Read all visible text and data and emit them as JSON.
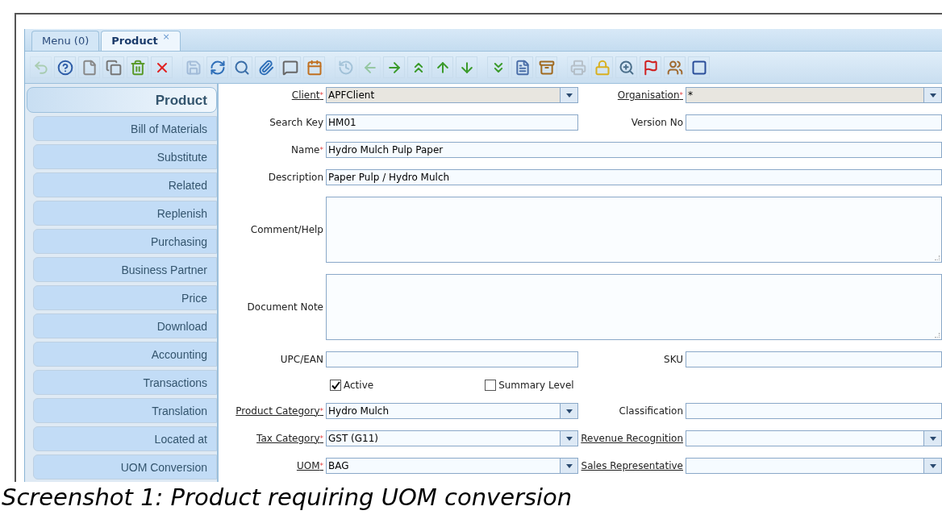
{
  "tabs": [
    {
      "label": "Menu (0)",
      "selected": false,
      "closable": false
    },
    {
      "label": "Product",
      "selected": true,
      "closable": true,
      "close": "×"
    }
  ],
  "toolbar": [
    {
      "disabled": true
    },
    {
      "disabled": false
    },
    {
      "disabled": false
    },
    {
      "disabled": false
    },
    {
      "disabled": false
    },
    {
      "disabled": false
    },
    {
      "disabled": true
    },
    {
      "disabled": false
    },
    {
      "disabled": false
    },
    {
      "disabled": false
    },
    {
      "disabled": false
    },
    {
      "disabled": false
    },
    {
      "disabled": true
    },
    {
      "disabled": true
    },
    {
      "disabled": false
    },
    {
      "disabled": false
    },
    {
      "disabled": false
    },
    {
      "disabled": false
    },
    {
      "disabled": false
    },
    {
      "disabled": false
    },
    {
      "disabled": false
    },
    {
      "disabled": true
    },
    {
      "disabled": false
    },
    {
      "disabled": false
    },
    {
      "disabled": false
    },
    {
      "disabled": false
    },
    {
      "disabled": false
    }
  ],
  "sidebar": {
    "items": [
      {
        "label": "Product",
        "selected": true
      },
      {
        "label": "Bill of Materials",
        "selected": false
      },
      {
        "label": "Substitute",
        "selected": false
      },
      {
        "label": "Related",
        "selected": false
      },
      {
        "label": "Replenish",
        "selected": false
      },
      {
        "label": "Purchasing",
        "selected": false
      },
      {
        "label": "Business Partner",
        "selected": false
      },
      {
        "label": "Price",
        "selected": false
      },
      {
        "label": "Download",
        "selected": false
      },
      {
        "label": "Accounting",
        "selected": false
      },
      {
        "label": "Transactions",
        "selected": false
      },
      {
        "label": "Translation",
        "selected": false
      },
      {
        "label": "Located at",
        "selected": false
      },
      {
        "label": "UOM Conversion",
        "selected": false
      }
    ]
  },
  "form": {
    "rows": [
      {
        "left": {
          "kind": "select",
          "label": "Client",
          "linked": true,
          "required": true,
          "readonly": true,
          "value": "APFClient"
        },
        "right": {
          "kind": "select",
          "label": "Organisation",
          "linked": true,
          "required": true,
          "readonly": true,
          "value": "*"
        }
      },
      {
        "left": {
          "kind": "text",
          "label": "Search Key",
          "linked": false,
          "required": false,
          "value": "HM01"
        },
        "right": {
          "kind": "text",
          "label": "Version No",
          "linked": false,
          "required": false
        }
      },
      {
        "left": {
          "kind": "text",
          "label": "Name",
          "linked": false,
          "required": true,
          "value": "Hydro Mulch Pulp Paper"
        }
      },
      {
        "left": {
          "kind": "text",
          "label": "Description",
          "linked": false,
          "required": false,
          "value": "Paper Pulp / Hydro Mulch"
        }
      },
      {
        "left": {
          "kind": "textarea",
          "label": "Comment/Help",
          "linked": false,
          "required": false
        }
      },
      {
        "left": {
          "kind": "textarea",
          "label": "Document Note",
          "linked": false,
          "required": false
        }
      },
      {
        "left": {
          "kind": "text",
          "label": "UPC/EAN",
          "linked": false,
          "required": false
        },
        "right": {
          "kind": "text",
          "label": "SKU",
          "linked": false,
          "required": false
        }
      },
      {
        "left": {
          "kind": "checkbox",
          "label": "Active",
          "checked": true
        },
        "right": {
          "kind": "checkbox",
          "label": "Summary Level",
          "checked": false
        }
      },
      {
        "left": {
          "kind": "select",
          "label": "Product Category",
          "linked": true,
          "required": true,
          "readonly": false,
          "value": "Hydro Mulch"
        },
        "right": {
          "kind": "text",
          "label": "Classification",
          "linked": false,
          "required": false
        }
      },
      {
        "left": {
          "kind": "select",
          "label": "Tax Category",
          "linked": true,
          "required": true,
          "readonly": false,
          "value": "GST (G11)"
        },
        "right": {
          "kind": "select",
          "label": "Revenue Recognition",
          "linked": true,
          "required": false,
          "readonly": false
        }
      },
      {
        "left": {
          "kind": "select",
          "label": "UOM",
          "linked": true,
          "required": true,
          "readonly": false,
          "value": "BAG"
        },
        "right": {
          "kind": "select",
          "label": "Sales Representative",
          "linked": true,
          "required": false,
          "readonly": false
        }
      }
    ]
  },
  "caption": "Screenshot 1: Product requiring UOM conversion"
}
